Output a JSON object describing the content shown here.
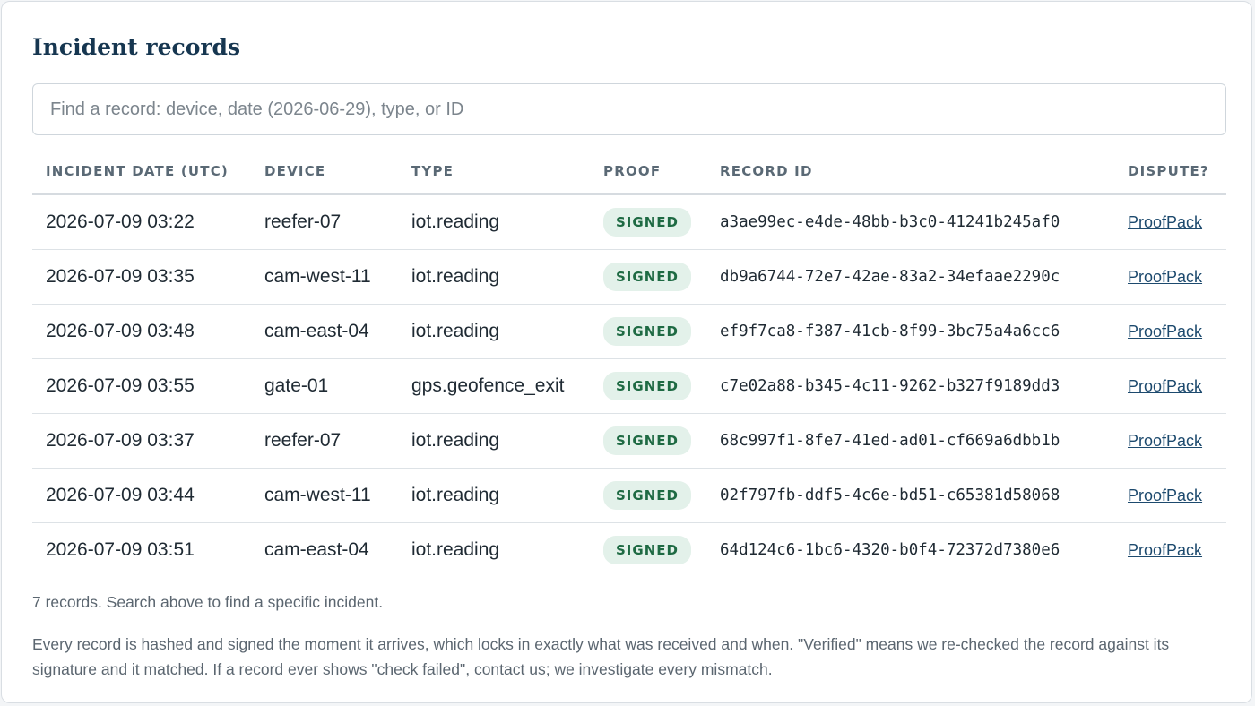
{
  "page": {
    "title": "Incident records",
    "search_placeholder": "Find a record: device, date (2026-06-29), type, or ID",
    "search_value": ""
  },
  "table": {
    "headers": {
      "date": "INCIDENT DATE (UTC)",
      "device": "DEVICE",
      "type": "TYPE",
      "proof": "PROOF",
      "record_id": "RECORD ID",
      "dispute": "DISPUTE?"
    },
    "rows": [
      {
        "date": "2026-07-09 03:22",
        "device": "reefer-07",
        "type": "iot.reading",
        "proof": "SIGNED",
        "record_id": "a3ae99ec-e4de-48bb-b3c0-41241b245af0",
        "dispute": "ProofPack"
      },
      {
        "date": "2026-07-09 03:35",
        "device": "cam-west-11",
        "type": "iot.reading",
        "proof": "SIGNED",
        "record_id": "db9a6744-72e7-42ae-83a2-34efaae2290c",
        "dispute": "ProofPack"
      },
      {
        "date": "2026-07-09 03:48",
        "device": "cam-east-04",
        "type": "iot.reading",
        "proof": "SIGNED",
        "record_id": "ef9f7ca8-f387-41cb-8f99-3bc75a4a6cc6",
        "dispute": "ProofPack"
      },
      {
        "date": "2026-07-09 03:55",
        "device": "gate-01",
        "type": "gps.geofence_exit",
        "proof": "SIGNED",
        "record_id": "c7e02a88-b345-4c11-9262-b327f9189dd3",
        "dispute": "ProofPack"
      },
      {
        "date": "2026-07-09 03:37",
        "device": "reefer-07",
        "type": "iot.reading",
        "proof": "SIGNED",
        "record_id": "68c997f1-8fe7-41ed-ad01-cf669a6dbb1b",
        "dispute": "ProofPack"
      },
      {
        "date": "2026-07-09 03:44",
        "device": "cam-west-11",
        "type": "iot.reading",
        "proof": "SIGNED",
        "record_id": "02f797fb-ddf5-4c6e-bd51-c65381d58068",
        "dispute": "ProofPack"
      },
      {
        "date": "2026-07-09 03:51",
        "device": "cam-east-04",
        "type": "iot.reading",
        "proof": "SIGNED",
        "record_id": "64d124c6-1bc6-4320-b0f4-72372d7380e6",
        "dispute": "ProofPack"
      }
    ]
  },
  "footer": {
    "count_text": "7 records. Search above to find a specific incident.",
    "note": "Every record is hashed and signed the moment it arrives, which locks in exactly what was received and when. \"Verified\" means we re-checked the record against its signature and it matched. If a record ever shows \"check failed\", contact us; we investigate every mismatch."
  },
  "colors": {
    "title": "#163650",
    "badge_bg": "#e3f1ea",
    "badge_text": "#1e6a43",
    "link": "#1d4a6e"
  }
}
